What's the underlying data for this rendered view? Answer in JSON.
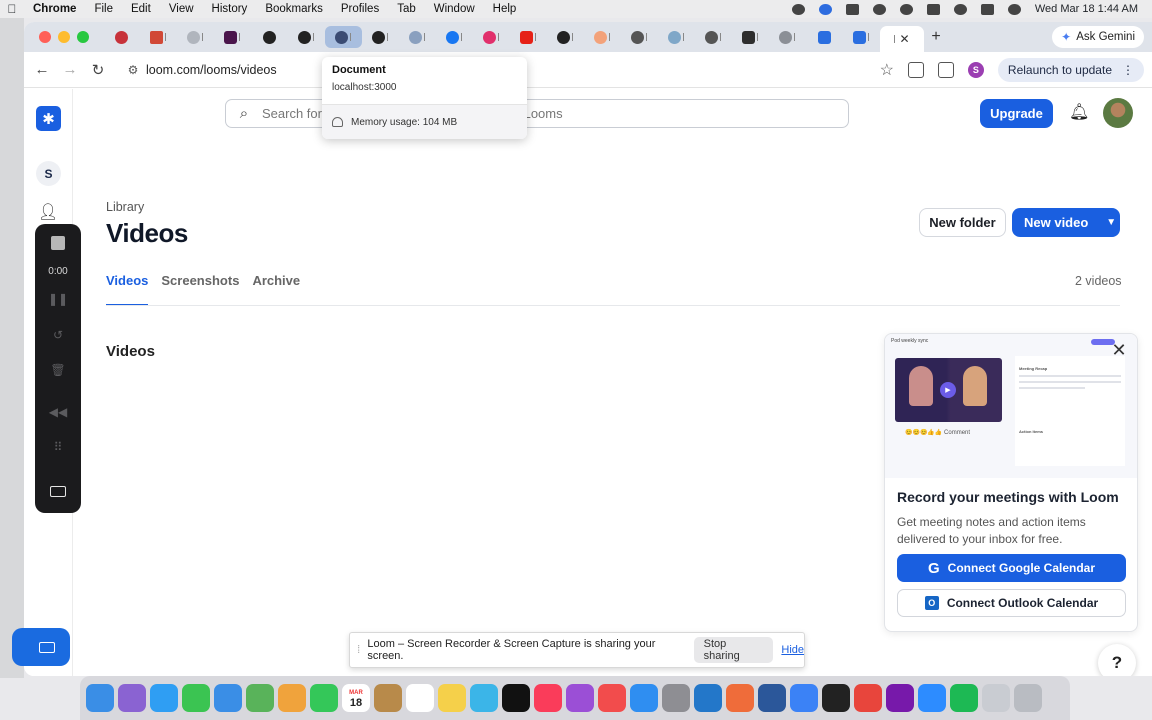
{
  "menubar": {
    "app_name": "Chrome",
    "items": [
      "File",
      "Edit",
      "View",
      "History",
      "Bookmarks",
      "Profiles",
      "Tab",
      "Window",
      "Help"
    ],
    "clock": "Wed Mar 18  1:44 AM"
  },
  "browser": {
    "ask_gemini": "Ask Gemini",
    "url": "loom.com/looms/videos",
    "relaunch": "Relaunch to update",
    "profile_initial": "S",
    "new_tab_symbol": "+",
    "tooltip": {
      "title": "Document",
      "subtitle": "localhost:3000",
      "memory": "Memory usage: 104 MB"
    }
  },
  "loom": {
    "workspace_initial": "S",
    "search_placeholder": "Search for people, tags, folders, spaces, and Looms",
    "upgrade": "Upgrade",
    "breadcrumb": "Library",
    "title": "Videos",
    "new_folder": "New folder",
    "new_video": "New video",
    "tabs": [
      "Videos",
      "Screenshots",
      "Archive"
    ],
    "video_count": "2 videos",
    "section_title": "Videos",
    "recorder": {
      "time": "0:00"
    },
    "promo": {
      "headline": "Record your meetings with Loom",
      "description": "Get meeting notes and action items delivered to your inbox for free.",
      "google_button": "Connect Google Calendar",
      "outlook_button": "Connect Outlook Calendar",
      "preview_title": "Pod weekly sync",
      "preview_section": "Meeting Recap",
      "preview_actions": "Action Items",
      "preview_comment": "Comment"
    },
    "help": "?"
  },
  "share_bar": {
    "message": "Loom – Screen Recorder & Screen Capture is sharing your screen.",
    "stop": "Stop sharing",
    "hide": "Hide"
  },
  "dock": {
    "calendar_day": "18",
    "calendar_month": "MAR"
  },
  "colors": {
    "accent": "#1a5fe0",
    "recorder_bg": "#1b1b1d",
    "tab_strip": "#dfe3ea"
  }
}
